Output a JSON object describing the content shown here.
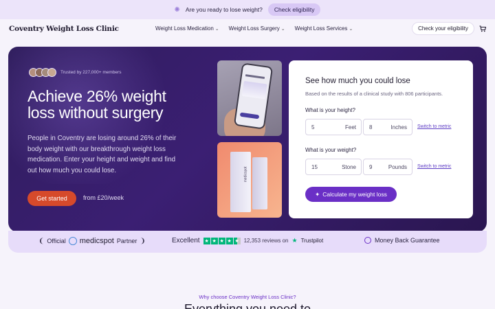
{
  "announcement": {
    "text": "Are you ready to lose weight?",
    "button": "Check eligibility"
  },
  "nav": {
    "logo": "Coventry Weight Loss Clinic",
    "items": [
      {
        "label": "Weight Loss Medication"
      },
      {
        "label": "Weight Loss Surgery"
      },
      {
        "label": "Weight Loss Services"
      }
    ],
    "check_button": "Check your eligibility",
    "cart_icon": "cart-icon"
  },
  "hero": {
    "trusted": "Trusted by 227,000+ members",
    "headline": "Achieve 26% weight loss without surgery",
    "description": "People in Coventry are losing around 26% of their body weight with our breakthrough weight loss medication. Enter your height and weight and find out how much you could lose.",
    "cta": "Get started",
    "price": "from £20/week",
    "box_label": "medicspot"
  },
  "form": {
    "title": "See how much you could lose",
    "subtitle": "Based on the results of a clinical study with 806 participants.",
    "height_label": "What is your height?",
    "height_feet": {
      "value": "5",
      "unit": "Feet"
    },
    "height_inches": {
      "value": "8",
      "unit": "Inches"
    },
    "weight_label": "What is your weight?",
    "weight_stone": {
      "value": "15",
      "unit": "Stone"
    },
    "weight_pounds": {
      "value": "9",
      "unit": "Pounds"
    },
    "switch_metric": "Switch to metric",
    "calc_button": "Calculate my weight loss"
  },
  "trust": {
    "official": "Official",
    "brand": "medicspot",
    "partner": "Partner",
    "excellent": "Excellent",
    "reviews": "12,353 reviews on",
    "trustpilot": "Trustpilot",
    "rating": 4.5,
    "guarantee": "Money Back Guarantee"
  },
  "section": {
    "kicker": "Why choose Coventry Weight Loss Clinic?",
    "title": "Everything you need to"
  },
  "colors": {
    "accent": "#6a2fc6",
    "cta": "#d64a2b",
    "hero_bg": "#3b1f73",
    "trustpilot_green": "#00b67a"
  }
}
